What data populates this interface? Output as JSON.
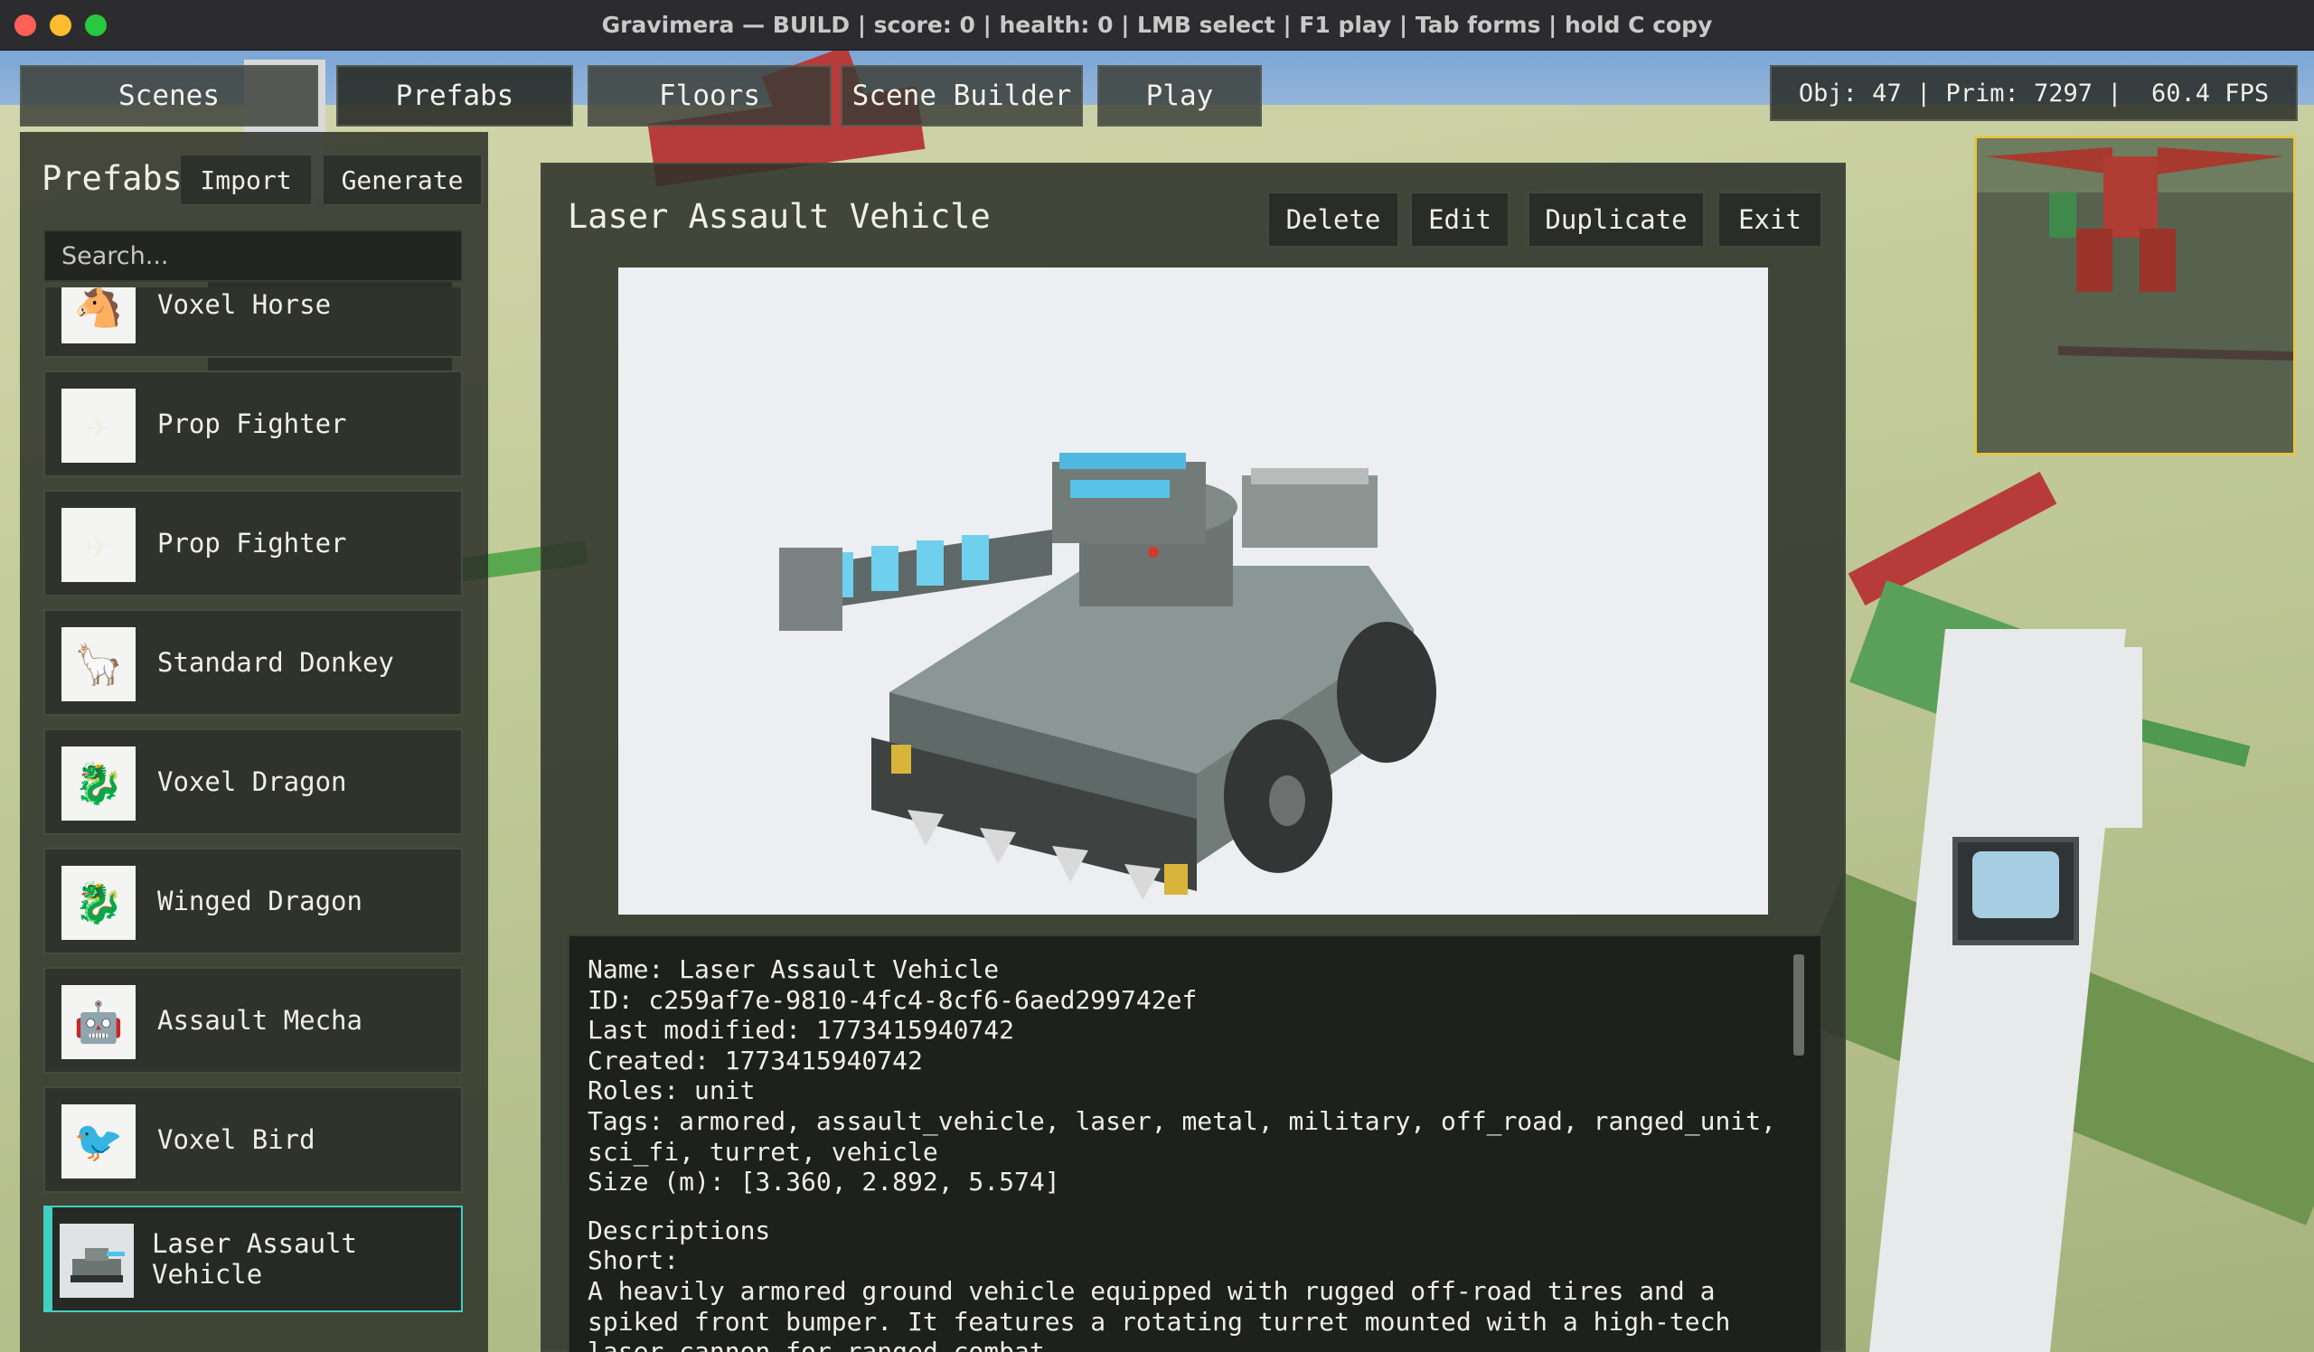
{
  "window": {
    "title": "Gravimera — BUILD | score: 0 | health: 0 | LMB select | F1 play | Tab forms | hold C copy"
  },
  "tabs": [
    {
      "label": "Scenes"
    },
    {
      "label": "Prefabs",
      "active": true
    },
    {
      "label": "Floors"
    },
    {
      "label": "Scene Builder"
    },
    {
      "label": "Play"
    }
  ],
  "stats": {
    "text": "Obj: 47 | Prim: 7297 |  60.4 FPS"
  },
  "sidebar": {
    "title": "Prefabs",
    "import_label": "Import",
    "generate_label": "Generate",
    "search_placeholder": "Search...",
    "items": [
      {
        "label": "Voxel Horse",
        "icon": "horse-icon"
      },
      {
        "label": "Prop Fighter",
        "icon": "plane-icon"
      },
      {
        "label": "Prop Fighter",
        "icon": "plane-icon"
      },
      {
        "label": "Standard Donkey",
        "icon": "donkey-icon"
      },
      {
        "label": "Voxel Dragon",
        "icon": "dragon-icon"
      },
      {
        "label": "Winged Dragon",
        "icon": "dragon-icon"
      },
      {
        "label": "Assault Mecha",
        "icon": "mecha-icon"
      },
      {
        "label": "Voxel Bird",
        "icon": "bird-icon"
      },
      {
        "label": "Laser Assault\nVehicle",
        "icon": "tank-icon",
        "selected": true
      }
    ]
  },
  "detail": {
    "title": "Laser Assault Vehicle",
    "buttons": {
      "delete": "Delete",
      "edit": "Edit",
      "duplicate": "Duplicate",
      "exit": "Exit"
    },
    "info": {
      "name": "Name: Laser Assault Vehicle",
      "id": "ID: c259af7e-9810-4fc4-8cf6-6aed299742ef",
      "modified": "Last modified: 1773415940742",
      "created": "Created: 1773415940742",
      "roles": "Roles: unit",
      "tags": "Tags: armored, assault_vehicle, laser, metal, military, off_road, ranged_unit, sci_fi, turret, vehicle",
      "size": "Size (m): [3.360, 2.892, 5.574]",
      "descriptions_heading": "Descriptions",
      "short_label": "Short:",
      "short_text": "A heavily armored ground vehicle equipped with rugged off-road tires and a spiked front bumper. It features a rotating turret mounted with a high-tech laser cannon for ranged combat."
    }
  },
  "colors": {
    "selected_accent": "#3fd0c0",
    "minimap_border": "#e5c54a"
  }
}
